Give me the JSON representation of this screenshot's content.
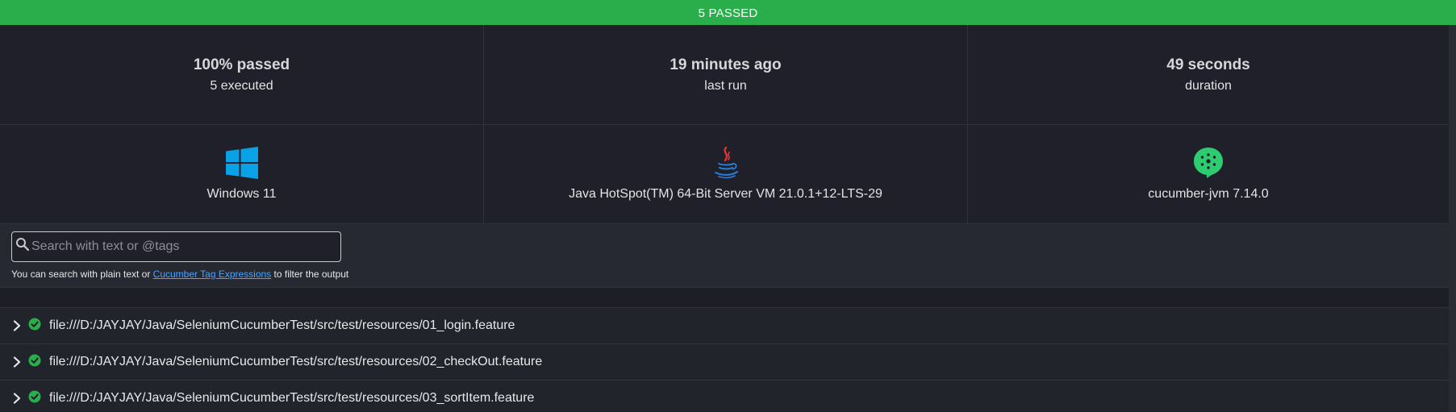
{
  "banner": {
    "text": "5 PASSED"
  },
  "stats": [
    {
      "main": "100% passed",
      "sub": "5 executed"
    },
    {
      "main": "19 minutes ago",
      "sub": "last run"
    },
    {
      "main": "49 seconds",
      "sub": "duration"
    }
  ],
  "environment": [
    {
      "icon": "windows-logo-icon",
      "label": "Windows 11"
    },
    {
      "icon": "java-logo-icon",
      "label": "Java HotSpot(TM) 64-Bit Server VM 21.0.1+12-LTS-29"
    },
    {
      "icon": "cucumber-logo-icon",
      "label": "cucumber-jvm 7.14.0"
    }
  ],
  "search": {
    "value": "",
    "placeholder": "Search with text or @tags",
    "hint_prefix": "You can search with plain text or ",
    "hint_link": "Cucumber Tag Expressions",
    "hint_suffix": " to filter the output"
  },
  "features": [
    {
      "name": "file:///D:/JAYJAY/Java/SeleniumCucumberTest/src/test/resources/01_login.feature",
      "status": "passed"
    },
    {
      "name": "file:///D:/JAYJAY/Java/SeleniumCucumberTest/src/test/resources/02_checkOut.feature",
      "status": "passed"
    },
    {
      "name": "file:///D:/JAYJAY/Java/SeleniumCucumberTest/src/test/resources/03_sortItem.feature",
      "status": "passed"
    }
  ],
  "colors": {
    "passed": "#2aae4b",
    "background": "#1e1f26",
    "link": "#4aa3ff",
    "windows": "#0aa2e6",
    "cucumber": "#2ecc71",
    "java_red": "#e3342f",
    "java_blue": "#2a7dd6"
  }
}
